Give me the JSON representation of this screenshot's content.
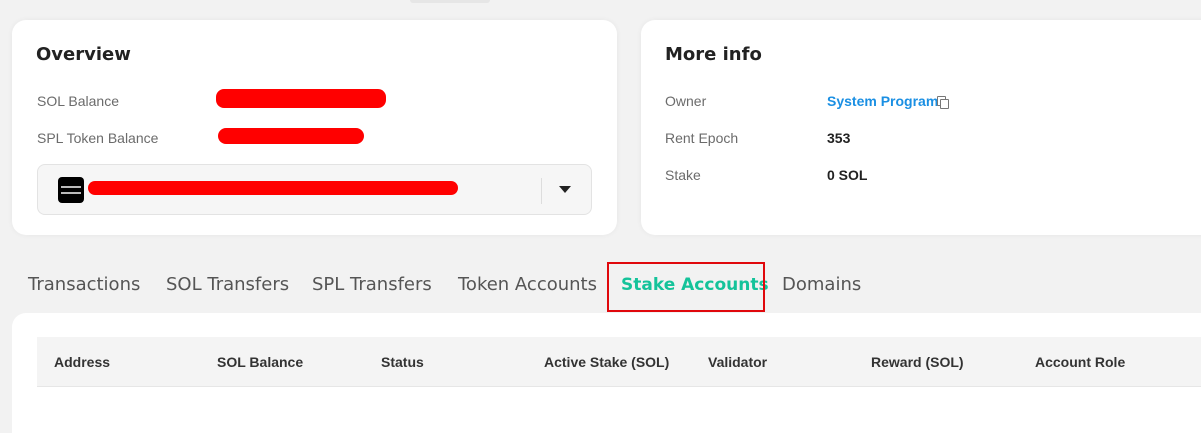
{
  "overview": {
    "title": "Overview",
    "sol_balance_label": "SOL Balance",
    "spl_token_balance_label": "SPL Token Balance"
  },
  "more_info": {
    "title": "More info",
    "owner_label": "Owner",
    "owner_value": "System Program",
    "rent_epoch_label": "Rent Epoch",
    "rent_epoch_value": "353",
    "stake_label": "Stake",
    "stake_value": "0 SOL"
  },
  "tabs": [
    {
      "label": "Transactions"
    },
    {
      "label": "SOL Transfers"
    },
    {
      "label": "SPL Transfers"
    },
    {
      "label": "Token Accounts"
    },
    {
      "label": "Stake Accounts",
      "active": true
    },
    {
      "label": "Domains"
    }
  ],
  "table": {
    "columns": [
      "Address",
      "SOL Balance",
      "Status",
      "Active Stake (SOL)",
      "Validator",
      "Reward (SOL)",
      "Account Role"
    ]
  },
  "colors": {
    "accent": "#14c39a",
    "link": "#1a8fe3",
    "redaction": "#ff0000",
    "highlight_border": "#e0080c"
  }
}
